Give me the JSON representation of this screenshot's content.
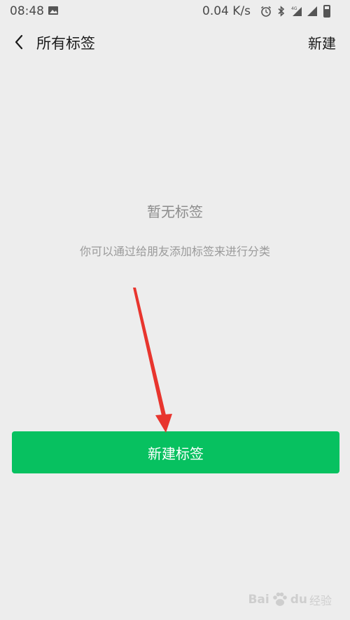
{
  "status_bar": {
    "time": "08:48",
    "speed": "0.04 K/s",
    "network_label": "4G"
  },
  "nav": {
    "title": "所有标签",
    "action": "新建"
  },
  "empty_state": {
    "title": "暂无标签",
    "description": "你可以通过给朋友添加标签来进行分类"
  },
  "primary_button": {
    "label": "新建标签",
    "color": "#07c160"
  },
  "annotation": {
    "arrow_color": "#e8352e"
  },
  "watermark": {
    "latin": "Bai",
    "latin2": "du",
    "cn": "经验"
  }
}
